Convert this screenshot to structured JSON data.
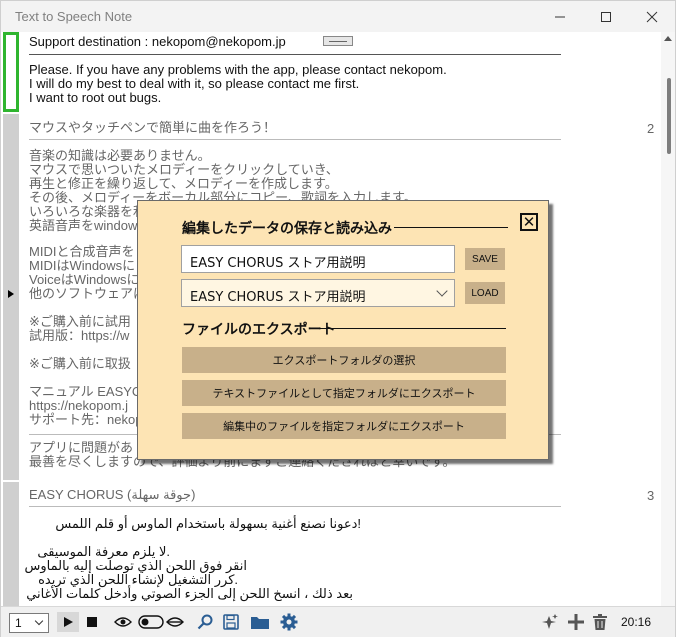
{
  "window": {
    "title": "Text to Speech Note"
  },
  "rows": [
    {
      "number": "",
      "lines": [
        "Support destination : nekopom@nekopom.jp",
        "",
        "Please. If you have any problems with the app, please contact nekopom.",
        "I will do my best to deal with it, so please contact me first.",
        "I want to root out bugs."
      ]
    },
    {
      "number": "2",
      "lines": [
        "マウスやタッチペンで簡単に曲を作ろう！",
        "",
        "音楽の知識は必要ありません。",
        "マウスで思いついたメロディーをクリックしていき、",
        "再生と修正を繰り返して、メロディーを作成します。",
        "その後、メロディーをボーカル部分にコピー、歌詞を入力します。",
        "いろいろな楽器を利",
        "英語音声をwindow",
        "",
        "MIDIと合成音声を",
        "MIDIはWindowsに",
        "VoiceはWindowsに",
        "他のソフトウェアは",
        "",
        "※ご購入前に試用",
        "試用版：https://w",
        "",
        "※ご購入前に取扱",
        "",
        "マニュアル EASYC",
        "https://nekopom.j",
        "サポート先：nekop",
        "",
        "アプリに問題があ",
        "最善を尽くしますので、評価より前にまずご連絡くださればと幸いです。"
      ]
    },
    {
      "number": "3",
      "lines": [
        "EASY CHORUS (جوقة سهلة)",
        "",
        "!دعونا نصنع أغنية بسهولة باستخدام الماوس أو قلم اللمس",
        "",
        ".لا يلزم معرفة الموسيقى",
        "انقر فوق اللحن الذي توصلت إليه بالماوس",
        ".كرر التشغيل لإنشاء اللحن الذي تريده",
        "بعد ذلك ، انسخ اللحن إلى الجزء الصوتي وأدخل كلمات الأغاني"
      ]
    }
  ],
  "dialog": {
    "heading_save_load": "編集したデータの保存と読み込み",
    "save_input_value": "EASY CHORUS ストア用説明",
    "save_button": "SAVE",
    "load_select_value": "EASY CHORUS ストア用説明",
    "load_button": "LOAD",
    "heading_export": "ファイルのエクスポート",
    "export_folder_button": "エクスポートフォルダの選択",
    "export_text_button": "テキストファイルとして指定フォルダにエクスポート",
    "export_file_button": "編集中のファイルを指定フォルダにエクスポート",
    "close_label": "✕"
  },
  "toolbar": {
    "row_select_value": "1",
    "clock": "20:16",
    "icons": [
      "play-icon",
      "stop-icon",
      "eye-icon",
      "toggle-icon",
      "search-icon",
      "save-icon",
      "folder-icon",
      "settings-icon",
      "sparkle-add-icon",
      "add-icon",
      "trash-icon"
    ]
  },
  "colors": {
    "dialog_bg": "#fde4b4",
    "dialog_button": "#c8b08a",
    "selected_marker": "#2fb52f",
    "toolbar_icon": "#2a5d93"
  }
}
